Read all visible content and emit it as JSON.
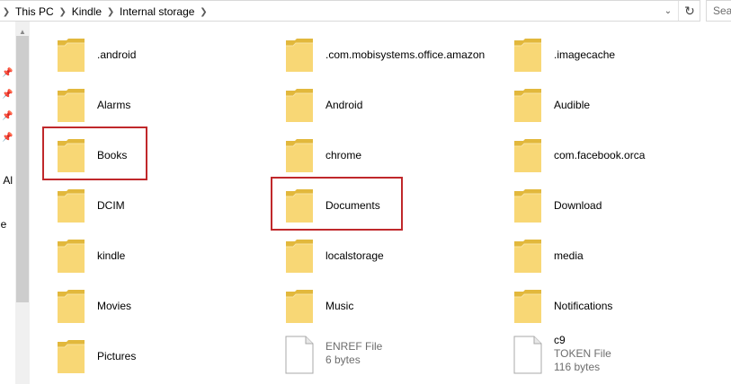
{
  "address_bar": {
    "breadcrumbs": [
      "This PC",
      "Kindle",
      "Internal storage"
    ],
    "search_placeholder": "Sea"
  },
  "nav_pane": {
    "partial_labels": [
      "n Al",
      "le"
    ]
  },
  "items": [
    {
      "name": ".android",
      "kind": "folder"
    },
    {
      "name": ".com.mobisystems.office.amazon",
      "kind": "folder"
    },
    {
      "name": ".imagecache",
      "kind": "folder"
    },
    {
      "name": "Alarms",
      "kind": "folder"
    },
    {
      "name": "Android",
      "kind": "folder"
    },
    {
      "name": "Audible",
      "kind": "folder"
    },
    {
      "name": "Books",
      "kind": "folder",
      "highlighted": true
    },
    {
      "name": "chrome",
      "kind": "folder"
    },
    {
      "name": "com.facebook.orca",
      "kind": "folder"
    },
    {
      "name": "DCIM",
      "kind": "folder"
    },
    {
      "name": "Documents",
      "kind": "folder",
      "highlighted": true
    },
    {
      "name": "Download",
      "kind": "folder"
    },
    {
      "name": "kindle",
      "kind": "folder"
    },
    {
      "name": "localstorage",
      "kind": "folder"
    },
    {
      "name": "media",
      "kind": "folder"
    },
    {
      "name": "Movies",
      "kind": "folder"
    },
    {
      "name": "Music",
      "kind": "folder"
    },
    {
      "name": "Notifications",
      "kind": "folder"
    },
    {
      "name": "Pictures",
      "kind": "folder"
    },
    {
      "name": "",
      "kind": "file",
      "type_label": "ENREF File",
      "size": "6 bytes"
    },
    {
      "name": "c9",
      "kind": "file",
      "type_label": "TOKEN File",
      "size": "116 bytes"
    }
  ],
  "colors": {
    "highlight_border": "#c0282b",
    "folder_front": "#f8d775",
    "folder_back": "#e2b83c"
  }
}
